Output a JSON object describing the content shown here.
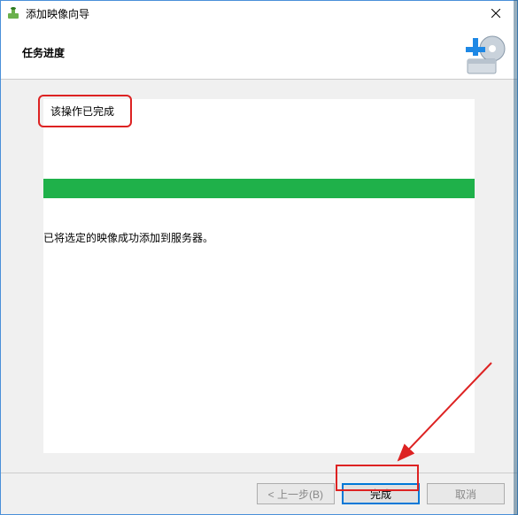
{
  "window": {
    "title": "添加映像向导"
  },
  "header": {
    "subtitle": "任务进度"
  },
  "content": {
    "status": "该操作已完成",
    "success_message": "已将选定的映像成功添加到服务器。"
  },
  "footer": {
    "back_label": "< 上一步(B)",
    "finish_label": "完成",
    "cancel_label": "取消"
  }
}
